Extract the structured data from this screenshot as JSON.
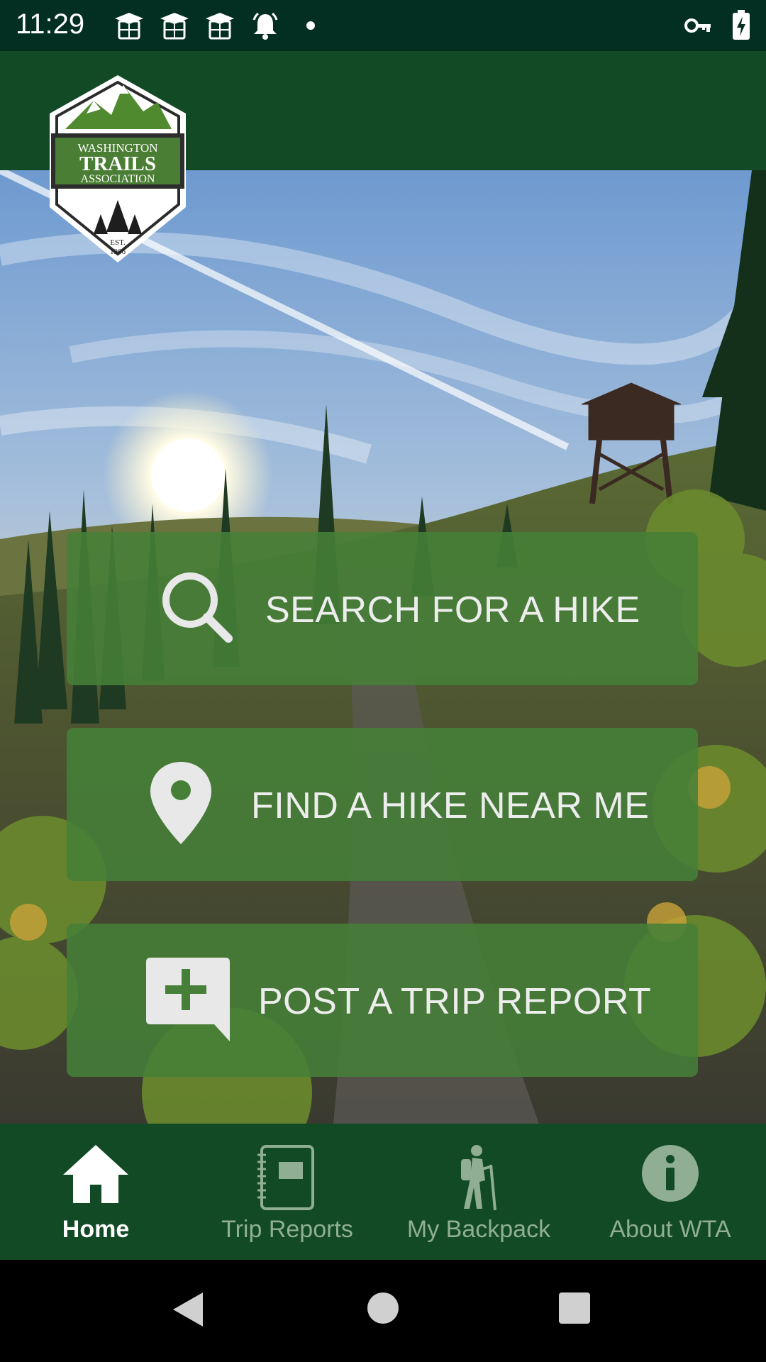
{
  "status_bar": {
    "time": "11:29",
    "left_icons": [
      "graduation-cap-icon",
      "graduation-cap-icon",
      "graduation-cap-icon",
      "bell-icon",
      "dot-icon"
    ],
    "right_icons": [
      "vpn-key-icon",
      "battery-charging-icon"
    ]
  },
  "logo": {
    "line1": "WASHINGTON",
    "line2": "TRAILS",
    "line3": "ASSOCIATION",
    "est": "EST.",
    "year": "1966"
  },
  "actions": [
    {
      "label": "SEARCH FOR A HIKE",
      "icon": "search-icon"
    },
    {
      "label": "FIND A HIKE NEAR ME",
      "icon": "location-pin-icon"
    },
    {
      "label": "POST A TRIP REPORT",
      "icon": "add-comment-icon"
    }
  ],
  "bottom_nav": {
    "items": [
      {
        "label": "Home",
        "icon": "home-icon",
        "active": true
      },
      {
        "label": "Trip Reports",
        "icon": "notebook-icon",
        "active": false
      },
      {
        "label": "My Backpack",
        "icon": "hiker-icon",
        "active": false
      },
      {
        "label": "About WTA",
        "icon": "info-icon",
        "active": false
      }
    ]
  },
  "colors": {
    "header_green": "#124a25",
    "status_bar": "#032f22",
    "button_green": "#468038",
    "nav_inactive": "#8fae94"
  }
}
